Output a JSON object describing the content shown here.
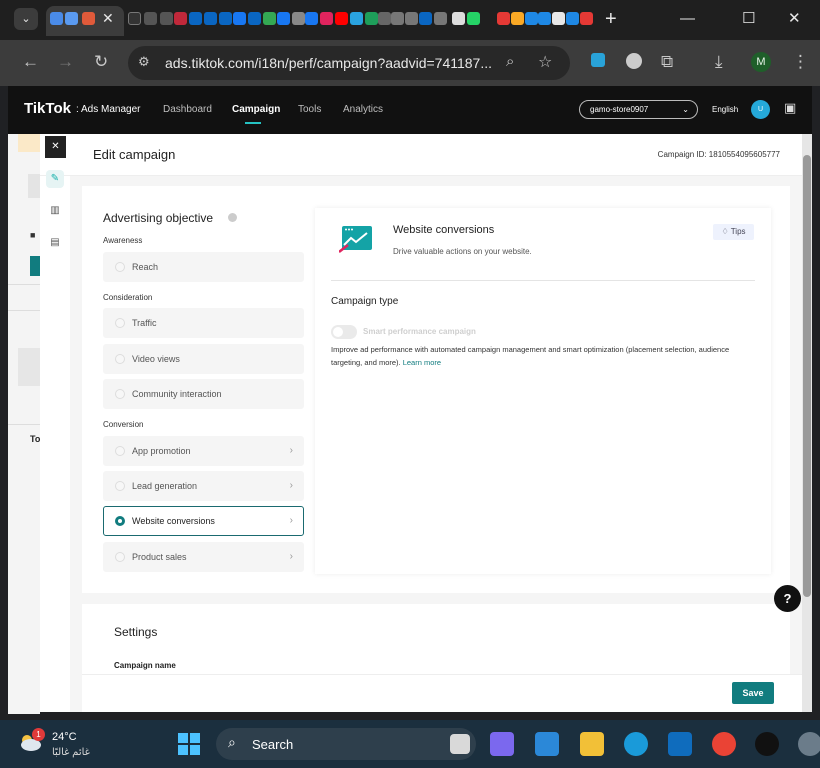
{
  "browser": {
    "tab_close": "✕",
    "new_tab": "+",
    "url": "ads.tiktok.com/i18n/perf/campaign?aadvid=741187...",
    "profile_initial": "M"
  },
  "header": {
    "logo": "TikTok",
    "logo_sub": ": Ads Manager",
    "nav": {
      "dashboard": "Dashboard",
      "campaign": "Campaign",
      "tools": "Tools",
      "analytics": "Analytics"
    },
    "account": "gamo-store0907",
    "language": "English",
    "user_initial": "U"
  },
  "drawer": {
    "title": "Edit campaign",
    "campaign_id": "Campaign ID: 1810554095605777",
    "close": "✕"
  },
  "objective": {
    "title": "Advertising objective",
    "sections": {
      "awareness": "Awareness",
      "consideration": "Consideration",
      "conversion": "Conversion"
    },
    "options": {
      "reach": "Reach",
      "traffic": "Traffic",
      "video_views": "Video views",
      "community": "Community interaction",
      "app_promotion": "App promotion",
      "lead_generation": "Lead generation",
      "website_conversions": "Website conversions",
      "product_sales": "Product sales"
    },
    "selected": "Website conversions"
  },
  "detail": {
    "title": "Website conversions",
    "description": "Drive valuable actions on your website.",
    "tips": "Tips",
    "campaign_type_title": "Campaign type",
    "smart_label": "Smart performance campaign",
    "smart_desc": "Improve ad performance with automated campaign management and smart optimization (placement selection, audience targeting, and more).",
    "learn_more": "Learn more"
  },
  "settings": {
    "title": "Settings",
    "campaign_name_label": "Campaign name",
    "save": "Save"
  },
  "help": "?",
  "taskbar": {
    "weather_temp": "24°C",
    "weather_cond": "غائم غالبًا",
    "weather_badge": "1",
    "search": "Search"
  },
  "colors": {
    "accent": "#117c7f",
    "tiktok_bg": "#111111",
    "taskbar": "#1b2f3e"
  }
}
